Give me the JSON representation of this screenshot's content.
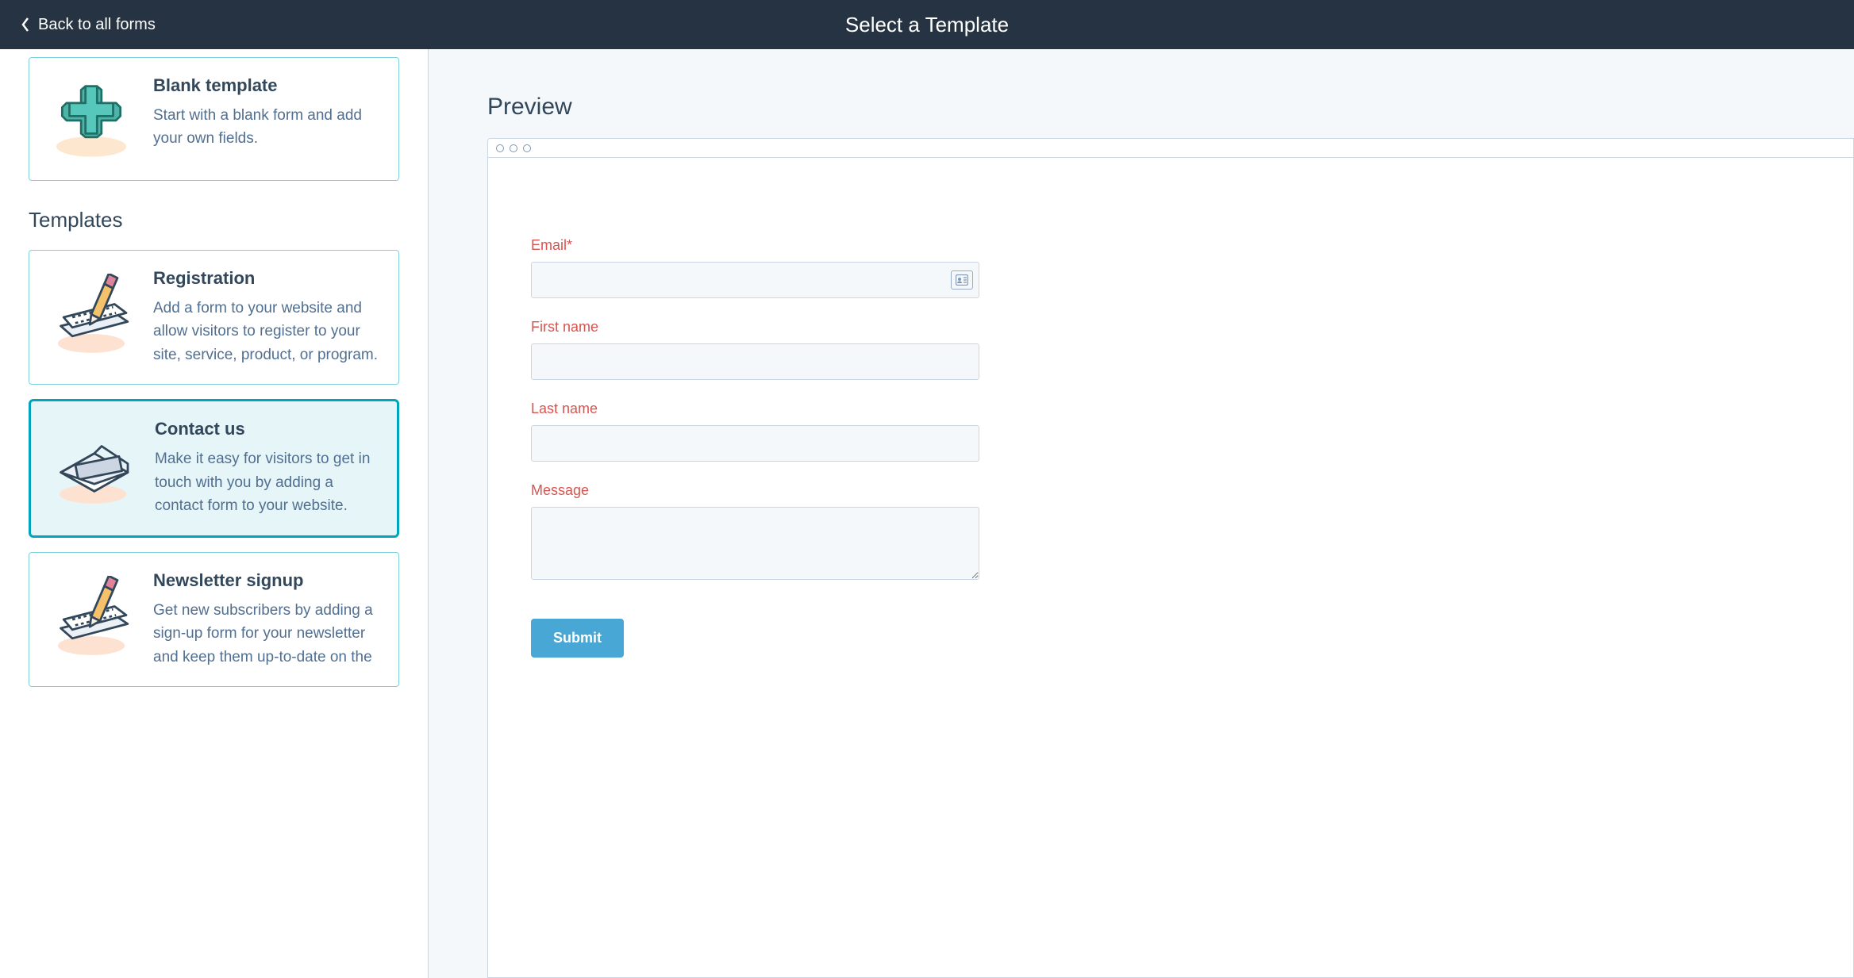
{
  "header": {
    "back_label": "Back to all forms",
    "title": "Select a Template"
  },
  "sidebar": {
    "blank": {
      "title": "Blank template",
      "desc": "Start with a blank form and add your own fields."
    },
    "section_title": "Templates",
    "templates": [
      {
        "title": "Registration",
        "desc": "Add a form to your website and allow visitors to register to your site, service, product, or program."
      },
      {
        "title": "Contact us",
        "desc": "Make it easy for visitors to get in touch with you by adding a contact form to your website."
      },
      {
        "title": "Newsletter signup",
        "desc": "Get new subscribers by adding a sign-up form for your newsletter and keep them up-to-date on the"
      }
    ],
    "selected_index": 1
  },
  "preview": {
    "title": "Preview",
    "fields": [
      {
        "label": "Email*",
        "type": "input",
        "has_icon": true
      },
      {
        "label": "First name",
        "type": "input",
        "has_icon": false
      },
      {
        "label": "Last name",
        "type": "input",
        "has_icon": false
      },
      {
        "label": "Message",
        "type": "textarea",
        "has_icon": false
      }
    ],
    "submit_label": "Submit"
  }
}
